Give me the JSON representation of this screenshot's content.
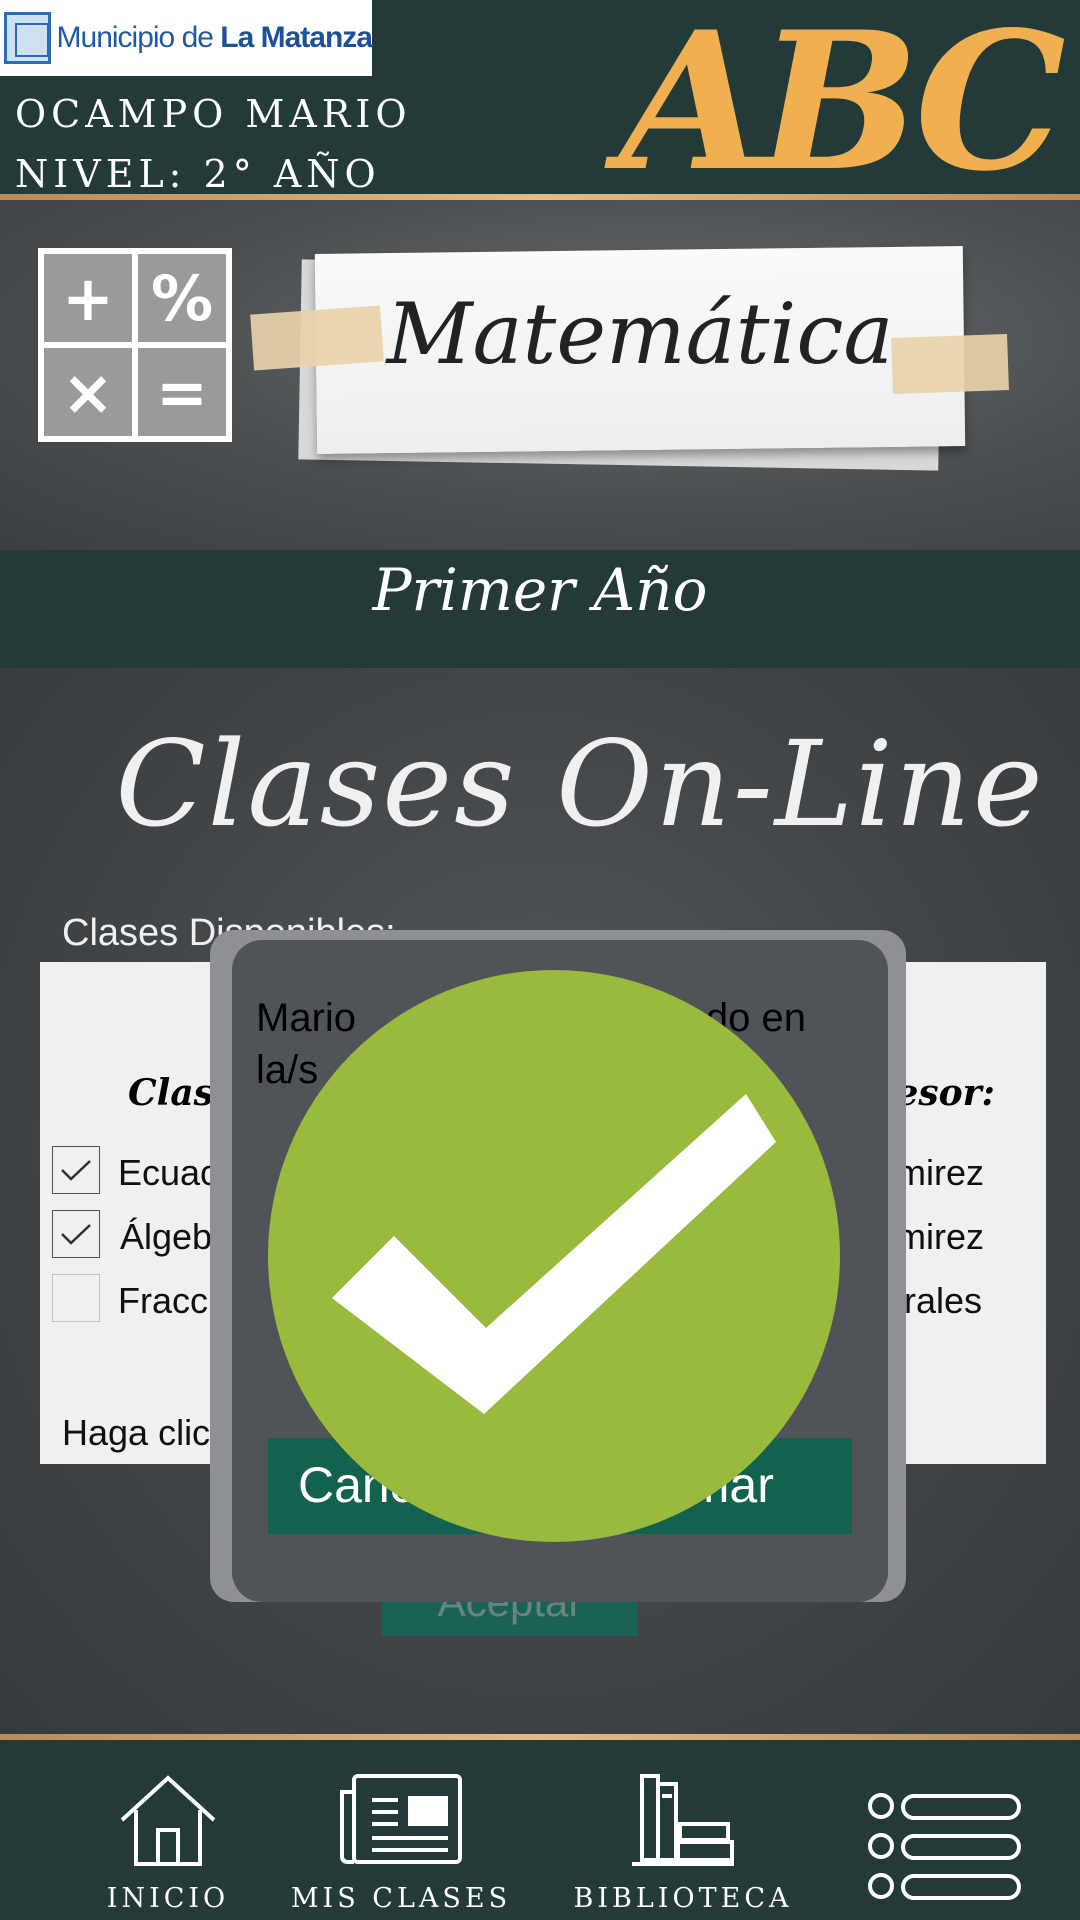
{
  "header": {
    "logo_prefix": "Municipio de ",
    "logo_bold": "La Matanza",
    "user_name": "OCAMPO MARIO",
    "user_level": "NIVEL: 2° AÑO",
    "brand": "ABC"
  },
  "subject": {
    "title": "Matemática",
    "calculator_symbols": [
      "+",
      "%",
      "×",
      "="
    ]
  },
  "course": {
    "year": "Primer Año"
  },
  "section": {
    "title": "Clases On-Line",
    "available_label": "Clases Disponibles:"
  },
  "table": {
    "col_class": "Clase",
    "col_prof": "fesor:",
    "rows": [
      {
        "class": "Ecuacio",
        "checked": true,
        "professor": "amirez"
      },
      {
        "class": "Álgebra",
        "checked": true,
        "professor": "amirez"
      },
      {
        "class": "Fraccio",
        "checked": false,
        "professor": "lorales"
      }
    ],
    "hint": "Haga click"
  },
  "accept_label": "Aceptar",
  "modal": {
    "message_line1": "Mario",
    "message_line1_end": "do en",
    "message_line2": "la/s",
    "cancel_label": "Canc",
    "confirm_label": "irmar"
  },
  "bottom_nav": [
    {
      "label": "INICIO",
      "icon": "home-icon"
    },
    {
      "label": "MIS CLASES",
      "icon": "newspaper-icon"
    },
    {
      "label": "BIBLIOTECA",
      "icon": "books-icon"
    },
    {
      "label": "",
      "icon": "menu-list-icon"
    }
  ],
  "colors": {
    "header_bg": "#233a38",
    "brand_accent": "#f0b04f",
    "button_green": "#13614f",
    "success_green": "#9aba3d",
    "modal_bg": "#505358"
  }
}
